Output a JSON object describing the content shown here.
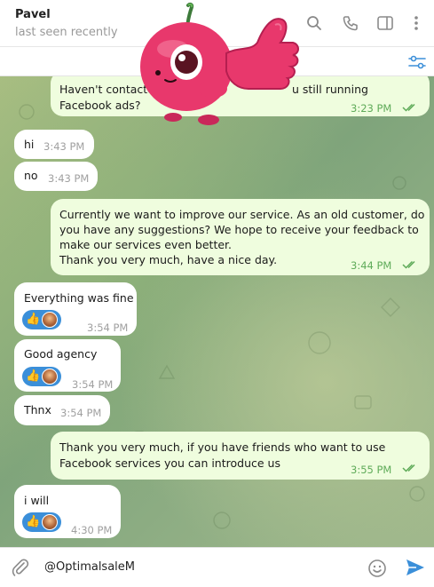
{
  "header": {
    "name": "Pavel",
    "status": "last seen recently",
    "icons": [
      "search-icon",
      "phone-icon",
      "sidebar-toggle-icon",
      "more-vertical-icon",
      "filter-icon"
    ]
  },
  "messages": [
    {
      "id": "m1",
      "direction": "out",
      "text": "Haven't contacted you for a while, are you still running Facebook ads?",
      "visible_lines": [
        "Haven't contacte",
        "u still running",
        "Facebook ads?"
      ],
      "time": "3:23 PM",
      "read": true
    },
    {
      "id": "m2",
      "direction": "in",
      "text": "hi",
      "time": "3:43 PM"
    },
    {
      "id": "m3",
      "direction": "in",
      "text": "no",
      "time": "3:43 PM"
    },
    {
      "id": "m4",
      "direction": "out",
      "lines": [
        "Currently we want to improve our service. As an old customer, do",
        "you have any suggestions? We hope to receive your feedback to",
        "make our services even better.",
        "Thank you very much, have a nice day."
      ],
      "time": "3:44 PM",
      "read": true
    },
    {
      "id": "m5",
      "direction": "in",
      "text": "Everything was fine",
      "time": "3:54 PM",
      "reaction": "👍"
    },
    {
      "id": "m6",
      "direction": "in",
      "text": "Good agency",
      "time": "3:54 PM",
      "reaction": "👍"
    },
    {
      "id": "m7",
      "direction": "in",
      "text": "Thnx",
      "time": "3:54 PM"
    },
    {
      "id": "m8",
      "direction": "out",
      "lines": [
        "Thank you very much, if you have friends who want to use",
        "Facebook services you can introduce us"
      ],
      "time": "3:55 PM",
      "read": true
    },
    {
      "id": "m9",
      "direction": "in",
      "text": "i will",
      "time": "4:30 PM",
      "reaction": "👍"
    }
  ],
  "composer": {
    "value": "@OptimalsaleM",
    "icons": [
      "attach-icon",
      "emoji-icon",
      "send-icon"
    ]
  },
  "colors": {
    "outgoing_bubble": "#effdde",
    "incoming_bubble": "#ffffff",
    "read_check": "#5fab59",
    "accent": "#3b8fd9"
  }
}
